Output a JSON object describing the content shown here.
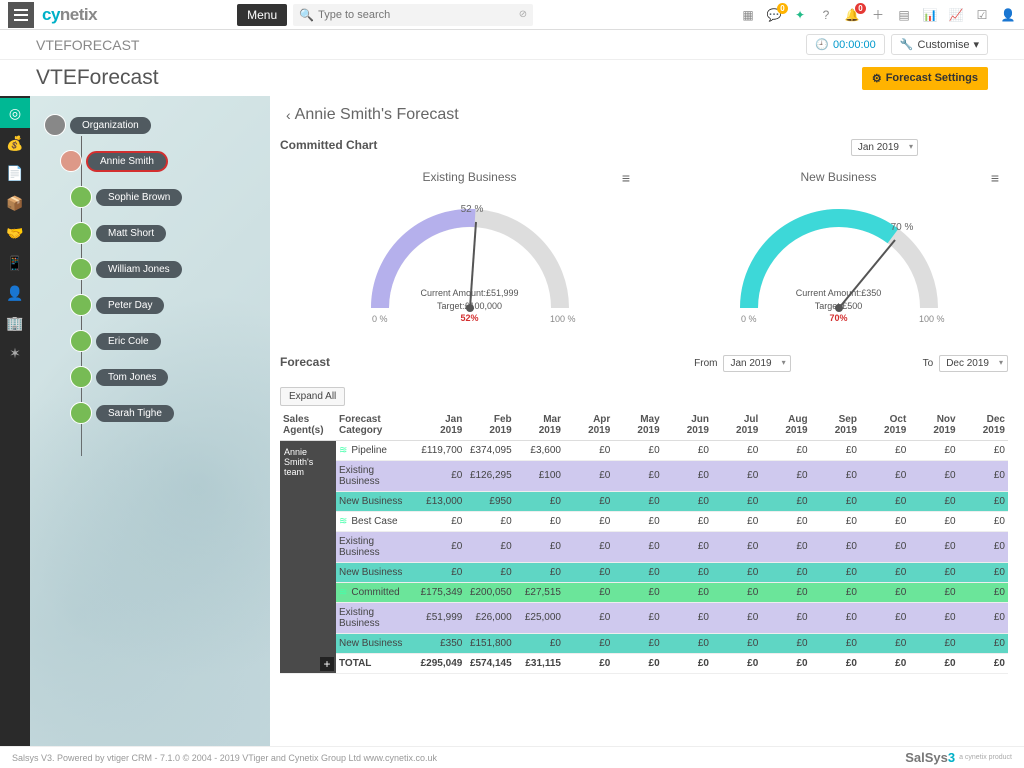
{
  "top": {
    "logo_a": "cy",
    "logo_b": "netix",
    "menu": "Menu",
    "search_placeholder": "Type to search",
    "notif1": "0",
    "notif2": "0"
  },
  "subbar": {
    "title": "VTEFORECAST",
    "timer": "00:00:00",
    "customise": "Customise"
  },
  "page": {
    "title": "VTEForecast",
    "settings": "Forecast Settings"
  },
  "org": {
    "root": "Organization",
    "selected": "Annie Smith",
    "children": [
      "Sophie Brown",
      "Matt Short",
      "William Jones",
      "Peter Day",
      "Eric Cole",
      "Tom Jones",
      "Sarah Tighe"
    ]
  },
  "main": {
    "title": "Annie Smith's Forecast",
    "committed_label": "Committed Chart",
    "month_sel": "Jan 2019",
    "gauge1": {
      "title": "Existing Business",
      "pct_label": "52 %",
      "lo": "0 %",
      "hi": "100 %",
      "amount": "Current Amount:£51,999",
      "target": "Target:£100,000",
      "pct": "52%"
    },
    "gauge2": {
      "title": "New Business",
      "pct_label": "70 %",
      "lo": "0 %",
      "hi": "100 %",
      "amount": "Current Amount:£350",
      "target": "Target:£500",
      "pct": "70%"
    },
    "forecast_label": "Forecast",
    "from_label": "From",
    "to_label": "To",
    "from_val": "Jan 2019",
    "to_val": "Dec 2019",
    "expand_all": "Expand All",
    "headers": {
      "agent": "Sales Agent(s)",
      "cat": "Forecast Category",
      "months": [
        "Jan 2019",
        "Feb 2019",
        "Mar 2019",
        "Apr 2019",
        "May 2019",
        "Jun 2019",
        "Jul 2019",
        "Aug 2019",
        "Sep 2019",
        "Oct 2019",
        "Nov 2019",
        "Dec 2019"
      ]
    },
    "agent_cell": "Annie Smith's team",
    "rows": [
      {
        "cls": "",
        "icon": true,
        "cat": "Pipeline",
        "vals": [
          "£119,700",
          "£374,095",
          "£3,600",
          "£0",
          "£0",
          "£0",
          "£0",
          "£0",
          "£0",
          "£0",
          "£0",
          "£0"
        ]
      },
      {
        "cls": "row-purple",
        "icon": false,
        "cat": "Existing Business",
        "vals": [
          "£0",
          "£126,295",
          "£100",
          "£0",
          "£0",
          "£0",
          "£0",
          "£0",
          "£0",
          "£0",
          "£0",
          "£0"
        ]
      },
      {
        "cls": "row-teal",
        "icon": false,
        "cat": "New Business",
        "vals": [
          "£13,000",
          "£950",
          "£0",
          "£0",
          "£0",
          "£0",
          "£0",
          "£0",
          "£0",
          "£0",
          "£0",
          "£0"
        ]
      },
      {
        "cls": "",
        "icon": true,
        "cat": "Best Case",
        "vals": [
          "£0",
          "£0",
          "£0",
          "£0",
          "£0",
          "£0",
          "£0",
          "£0",
          "£0",
          "£0",
          "£0",
          "£0"
        ]
      },
      {
        "cls": "row-purple",
        "icon": false,
        "cat": "Existing Business",
        "vals": [
          "£0",
          "£0",
          "£0",
          "£0",
          "£0",
          "£0",
          "£0",
          "£0",
          "£0",
          "£0",
          "£0",
          "£0"
        ]
      },
      {
        "cls": "row-teal",
        "icon": false,
        "cat": "New Business",
        "vals": [
          "£0",
          "£0",
          "£0",
          "£0",
          "£0",
          "£0",
          "£0",
          "£0",
          "£0",
          "£0",
          "£0",
          "£0"
        ]
      },
      {
        "cls": "row-green",
        "icon": true,
        "cat": "Committed",
        "vals": [
          "£175,349",
          "£200,050",
          "£27,515",
          "£0",
          "£0",
          "£0",
          "£0",
          "£0",
          "£0",
          "£0",
          "£0",
          "£0"
        ]
      },
      {
        "cls": "row-purple",
        "icon": false,
        "cat": "Existing Business",
        "vals": [
          "£51,999",
          "£26,000",
          "£25,000",
          "£0",
          "£0",
          "£0",
          "£0",
          "£0",
          "£0",
          "£0",
          "£0",
          "£0"
        ]
      },
      {
        "cls": "row-teal",
        "icon": false,
        "cat": "New Business",
        "vals": [
          "£350",
          "£151,800",
          "£0",
          "£0",
          "£0",
          "£0",
          "£0",
          "£0",
          "£0",
          "£0",
          "£0",
          "£0"
        ]
      },
      {
        "cls": "row-total",
        "icon": false,
        "cat": "TOTAL",
        "vals": [
          "£295,049",
          "£574,145",
          "£31,115",
          "£0",
          "£0",
          "£0",
          "£0",
          "£0",
          "£0",
          "£0",
          "£0",
          "£0"
        ]
      }
    ]
  },
  "footer": {
    "text": "Salsys V3. Powered by vtiger CRM - 7.1.0 © 2004 - 2019 VTiger and Cynetix Group Ltd www.cynetix.co.uk",
    "brand_a": "SalSys",
    "brand_b": "3",
    "sub": "a cynetix product"
  },
  "chart_data": [
    {
      "type": "gauge",
      "title": "Existing Business",
      "value_pct": 52,
      "range": [
        0,
        100
      ],
      "current_amount": 51999,
      "target": 100000,
      "currency": "GBP"
    },
    {
      "type": "gauge",
      "title": "New Business",
      "value_pct": 70,
      "range": [
        0,
        100
      ],
      "current_amount": 350,
      "target": 500,
      "currency": "GBP"
    }
  ]
}
